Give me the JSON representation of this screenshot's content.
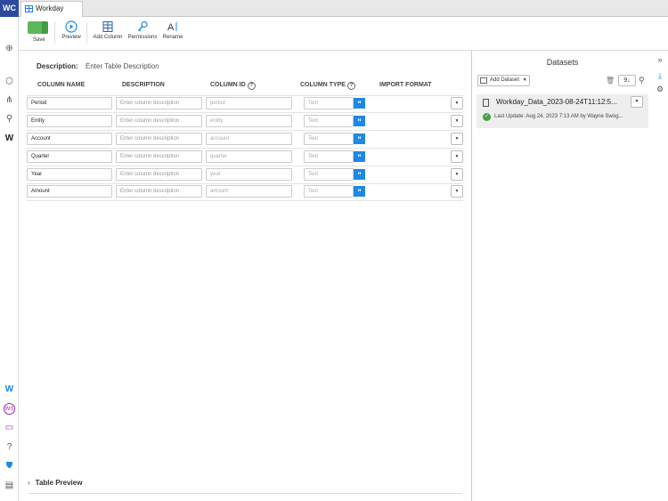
{
  "app": {
    "logo": "WC",
    "tab_title": "Workday Table"
  },
  "toolbar": {
    "save": "Save",
    "preview": "Preview",
    "add_column": "Add Column",
    "permissions": "Permissions",
    "rename": "Rename"
  },
  "table": {
    "description_label": "Description:",
    "description_placeholder": "Enter Table Description",
    "headers": {
      "column_name": "COLUMN NAME",
      "description": "DESCRIPTION",
      "column_id": "COLUMN ID",
      "column_type": "COLUMN TYPE",
      "import_format": "IMPORT FORMAT"
    },
    "rows": [
      {
        "name": "Period",
        "desc_placeholder": "Enter column description",
        "id": "period",
        "type": "Text"
      },
      {
        "name": "Entity",
        "desc_placeholder": "Enter column description",
        "id": "entity",
        "type": "Text"
      },
      {
        "name": "Account",
        "desc_placeholder": "Enter column description",
        "id": "account",
        "type": "Text"
      },
      {
        "name": "Quarter",
        "desc_placeholder": "Enter column description",
        "id": "quarter",
        "type": "Text"
      },
      {
        "name": "Year",
        "desc_placeholder": "Enter column description",
        "id": "year",
        "type": "Text"
      },
      {
        "name": "Amount",
        "desc_placeholder": "Enter column description",
        "id": "amount",
        "type": "Text"
      }
    ],
    "preview_label": "Table Preview"
  },
  "datasets": {
    "title": "Datasets",
    "add_dataset": "Add Dataset",
    "sort_label": "9↓",
    "items": [
      {
        "name": "Workday_Data_2023-08-24T11:12:5...",
        "last_update": "Last Update: Aug 24, 2023 7:13 AM by Wayne Swog..."
      }
    ]
  },
  "colors": {
    "brand": "#2b4c9c",
    "accent_blue": "#1e88e5",
    "save_green": "#5cb85c",
    "success": "#43a047"
  }
}
